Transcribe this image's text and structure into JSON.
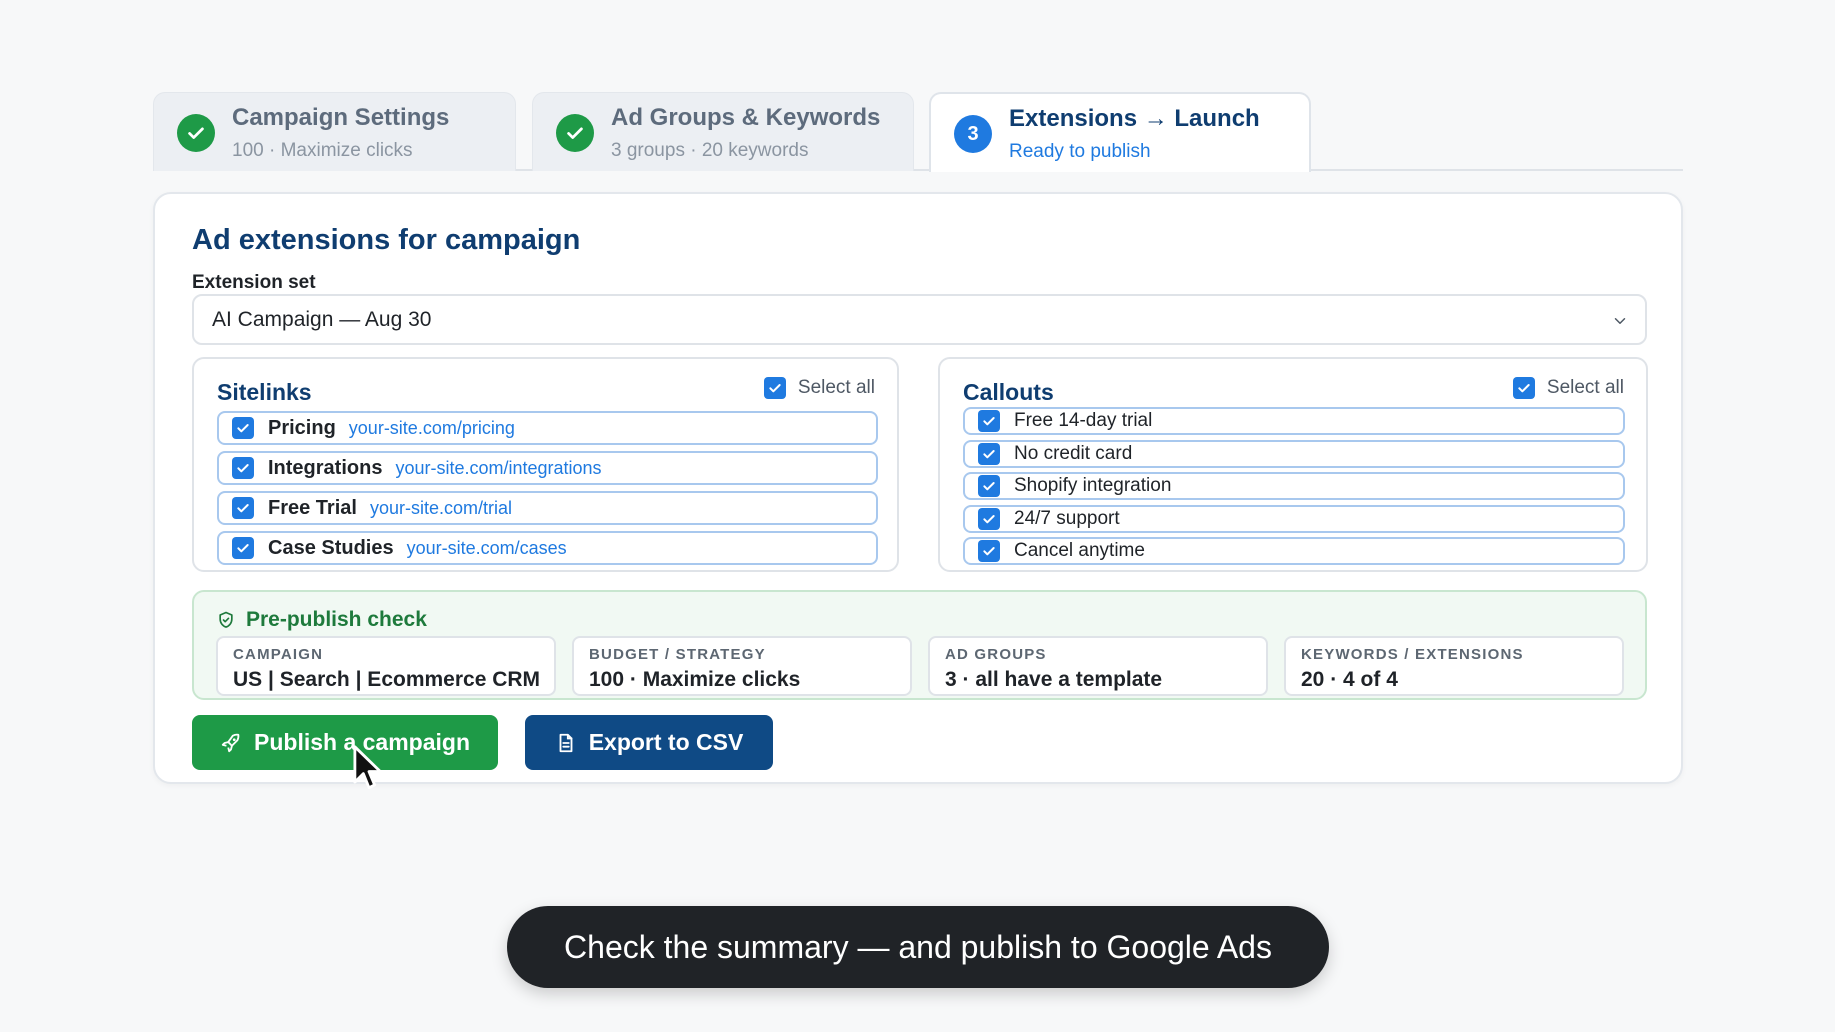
{
  "steps": [
    {
      "title": "Campaign Settings",
      "subtitle": "100 · Maximize clicks",
      "state": "done"
    },
    {
      "title": "Ad Groups & Keywords",
      "subtitle": "3 groups · 20 keywords",
      "state": "done"
    },
    {
      "number": "3",
      "title": "Extensions → Launch",
      "subtitle": "Ready to publish",
      "state": "current"
    }
  ],
  "card": {
    "title": "Ad extensions for campaign",
    "extension_set_label": "Extension set",
    "extension_set_value": "AI Campaign — Aug 30"
  },
  "sitelinks": {
    "title": "Sitelinks",
    "select_all_label": "Select all",
    "items": [
      {
        "name": "Pricing",
        "url": "your-site.com/pricing",
        "checked": true
      },
      {
        "name": "Integrations",
        "url": "your-site.com/integrations",
        "checked": true
      },
      {
        "name": "Free Trial",
        "url": "your-site.com/trial",
        "checked": true
      },
      {
        "name": "Case Studies",
        "url": "your-site.com/cases",
        "checked": true
      }
    ]
  },
  "callouts": {
    "title": "Callouts",
    "select_all_label": "Select all",
    "items": [
      {
        "text": "Free 14-day trial",
        "checked": true
      },
      {
        "text": "No credit card",
        "checked": true
      },
      {
        "text": "Shopify integration",
        "checked": true
      },
      {
        "text": "24/7 support",
        "checked": true
      },
      {
        "text": "Cancel anytime",
        "checked": true
      }
    ]
  },
  "prepublish": {
    "title": "Pre-publish check",
    "summary": [
      {
        "label": "CAMPAIGN",
        "value": "US | Search | Ecommerce CRM"
      },
      {
        "label": "BUDGET / STRATEGY",
        "value": "100 · Maximize clicks"
      },
      {
        "label": "AD GROUPS",
        "value": "3 · all have a template"
      },
      {
        "label": "KEYWORDS / EXTENSIONS",
        "value": "20 · 4 of 4"
      }
    ]
  },
  "actions": {
    "publish_label": "Publish a campaign",
    "export_label": "Export to CSV"
  },
  "caption": "Check the summary — and publish to Google Ads",
  "icons": {
    "step_done": "check-icon",
    "checkbox": "check-icon",
    "dropdown": "chevron-down-icon",
    "prepublish": "shield-check-icon",
    "publish": "rocket-icon",
    "export": "document-icon",
    "pointer": "mouse-cursor-icon"
  },
  "colors": {
    "primary_blue": "#1f7ae0",
    "navy": "#0f3d70",
    "success_green": "#1e9a47",
    "export_button": "#0f4a85",
    "caption_bg": "#202327"
  }
}
